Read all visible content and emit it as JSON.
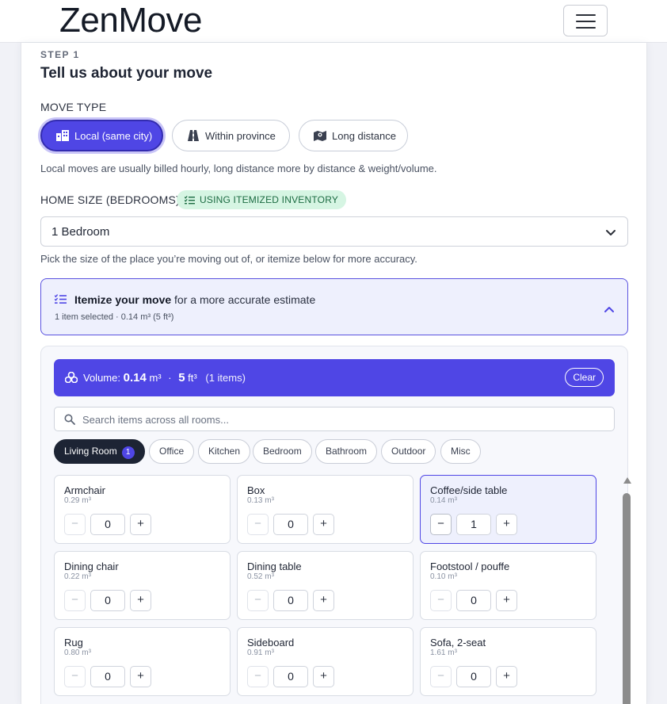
{
  "brand": "ZenMove",
  "step": {
    "label": "STEP 1",
    "title": "Tell us about your move"
  },
  "move_type": {
    "label": "MOVE TYPE",
    "options": [
      {
        "label": "Local (same city)",
        "icon": "city-icon",
        "selected": true
      },
      {
        "label": "Within province",
        "icon": "road-icon",
        "selected": false
      },
      {
        "label": "Long distance",
        "icon": "map-icon",
        "selected": false
      }
    ],
    "help": "Local moves are usually billed hourly, long distance more by distance & weight/volume."
  },
  "home_size": {
    "label": "HOME SIZE (BEDROOMS)",
    "badge": "USING ITEMIZED INVENTORY",
    "selected": "1 Bedroom",
    "help": "Pick the size of the place you’re moving out of, or itemize below for more accuracy."
  },
  "itemize": {
    "title_bold": "Itemize your move",
    "title_rest": " for a more accurate estimate",
    "summary": "1 item selected · 0.14 m³ (5 ft³)"
  },
  "volume": {
    "label": "Volume:",
    "m3": "0.14",
    "m3_unit": "m³",
    "sep": "·",
    "ft3": "5",
    "ft3_unit": "ft³",
    "items": "(1 items)",
    "clear": "Clear"
  },
  "search": {
    "placeholder": "Search items across all rooms..."
  },
  "tabs": [
    {
      "label": "Living Room",
      "count": "1",
      "active": true
    },
    {
      "label": "Office"
    },
    {
      "label": "Kitchen"
    },
    {
      "label": "Bedroom"
    },
    {
      "label": "Bathroom"
    },
    {
      "label": "Outdoor"
    },
    {
      "label": "Misc"
    }
  ],
  "items": [
    {
      "name": "Armchair",
      "volume": "0.29 m³",
      "qty": "0"
    },
    {
      "name": "Box",
      "volume": "0.13 m³",
      "qty": "0"
    },
    {
      "name": "Coffee/side table",
      "volume": "0.14 m³",
      "qty": "1"
    },
    {
      "name": "Dining chair",
      "volume": "0.22 m³",
      "qty": "0"
    },
    {
      "name": "Dining table",
      "volume": "0.52 m³",
      "qty": "0"
    },
    {
      "name": "Footstool / pouffe",
      "volume": "0.10 m³",
      "qty": "0"
    },
    {
      "name": "Rug",
      "volume": "0.80 m³",
      "qty": "0"
    },
    {
      "name": "Sideboard",
      "volume": "0.91 m³",
      "qty": "0"
    },
    {
      "name": "Sofa, 2-seat",
      "volume": "1.61 m³",
      "qty": "0"
    }
  ],
  "stepper": {
    "minus": "−",
    "plus": "+"
  },
  "colors": {
    "accent": "#4f46e5",
    "accent_light": "#eef0fd",
    "success_bg": "#d6f5e3",
    "dark": "#1d2434"
  }
}
